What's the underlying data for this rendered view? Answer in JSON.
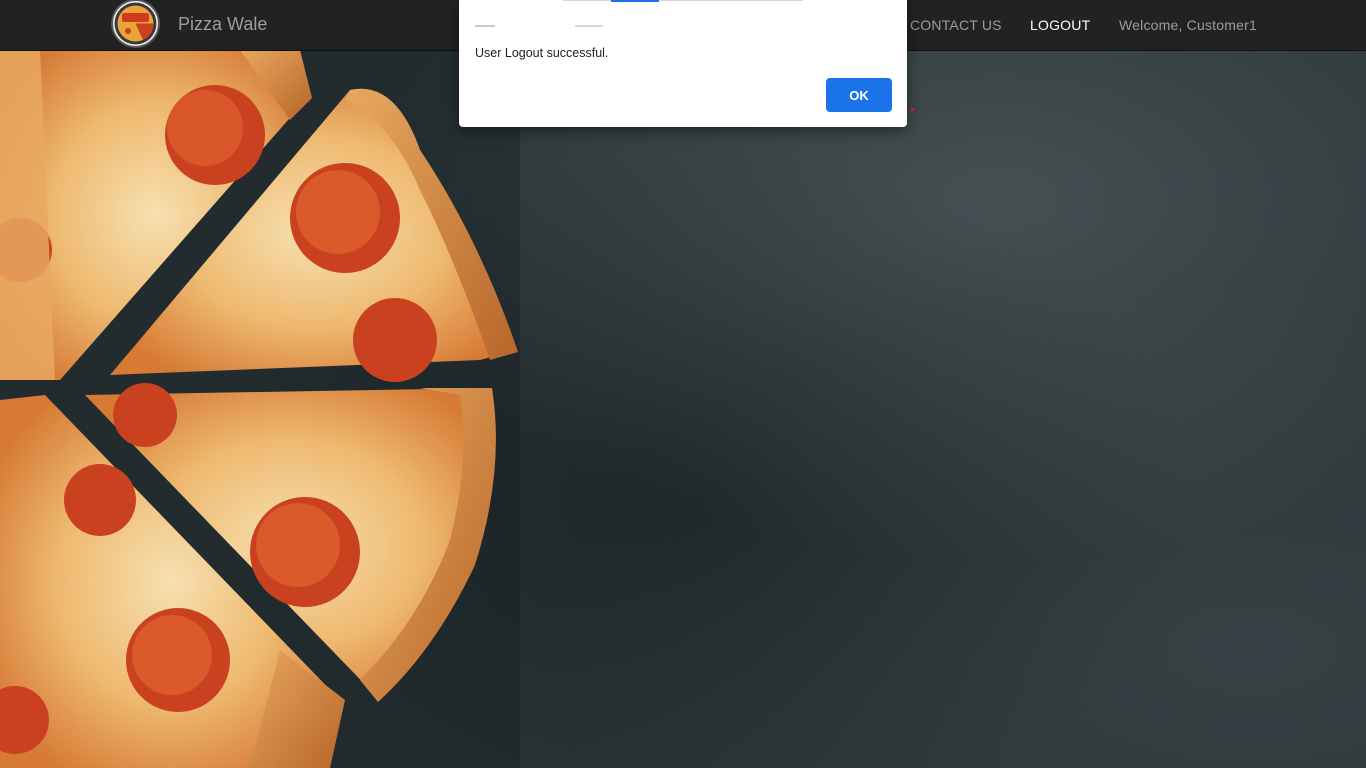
{
  "navbar": {
    "brand_name": "Pizza Wale",
    "logo_icon": "pizza-logo-icon",
    "links": {
      "contact": "CONTACT US",
      "logout": "LOGOUT",
      "welcome": "Welcome, Customer1"
    }
  },
  "dialog": {
    "message": "User Logout successful.",
    "ok_label": "OK"
  },
  "colors": {
    "navbar_bg": "#222222",
    "nav_text": "#9d9d9d",
    "nav_active": "#ffffff",
    "dialog_button": "#1a73e8"
  }
}
